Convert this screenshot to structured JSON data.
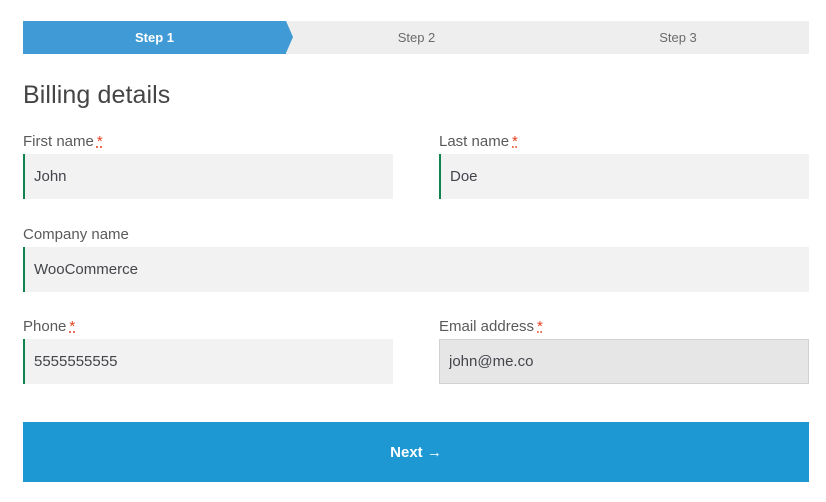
{
  "steps": [
    {
      "label": "Step 1",
      "active": true
    },
    {
      "label": "Step 2",
      "active": false
    },
    {
      "label": "Step 3",
      "active": false
    }
  ],
  "form": {
    "heading": "Billing details",
    "required_marker": "*",
    "first_name": {
      "label": "First name",
      "value": "John"
    },
    "last_name": {
      "label": "Last name",
      "value": "Doe"
    },
    "company": {
      "label": "Company name",
      "value": "WooCommerce"
    },
    "phone": {
      "label": "Phone",
      "value": "5555555555"
    },
    "email": {
      "label": "Email address",
      "value": "john@me.co"
    }
  },
  "next_button": {
    "label": "Next →"
  },
  "colors": {
    "step_active": "#3f9ad6",
    "step_bar": "#eeeeee",
    "valid_border": "#0f834d",
    "button": "#1e98d3",
    "required": "#e2401c"
  }
}
